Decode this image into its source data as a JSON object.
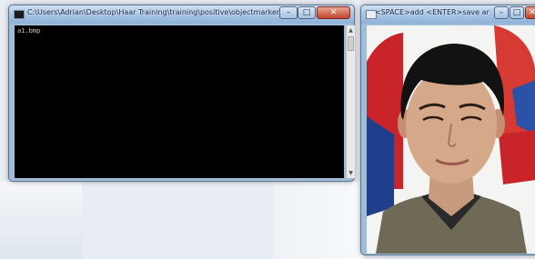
{
  "console_window": {
    "title": "C:\\Users\\Adrian\\Desktop\\Haar Training\\training\\positive\\objectmarker.exe",
    "output": "a1.bmp",
    "buttons": {
      "minimize": "–",
      "maximize": "□",
      "close": "✕"
    }
  },
  "image_window": {
    "title": "<SPACE>add <ENTER>save and load ...",
    "buttons": {
      "minimize": "–",
      "maximize": "□",
      "close": "✕"
    },
    "image_subject": "portrait photo of a man"
  },
  "colors": {
    "titlebar": "#a9c6e6",
    "console_bg": "#000000",
    "close_button": "#c0442c"
  }
}
